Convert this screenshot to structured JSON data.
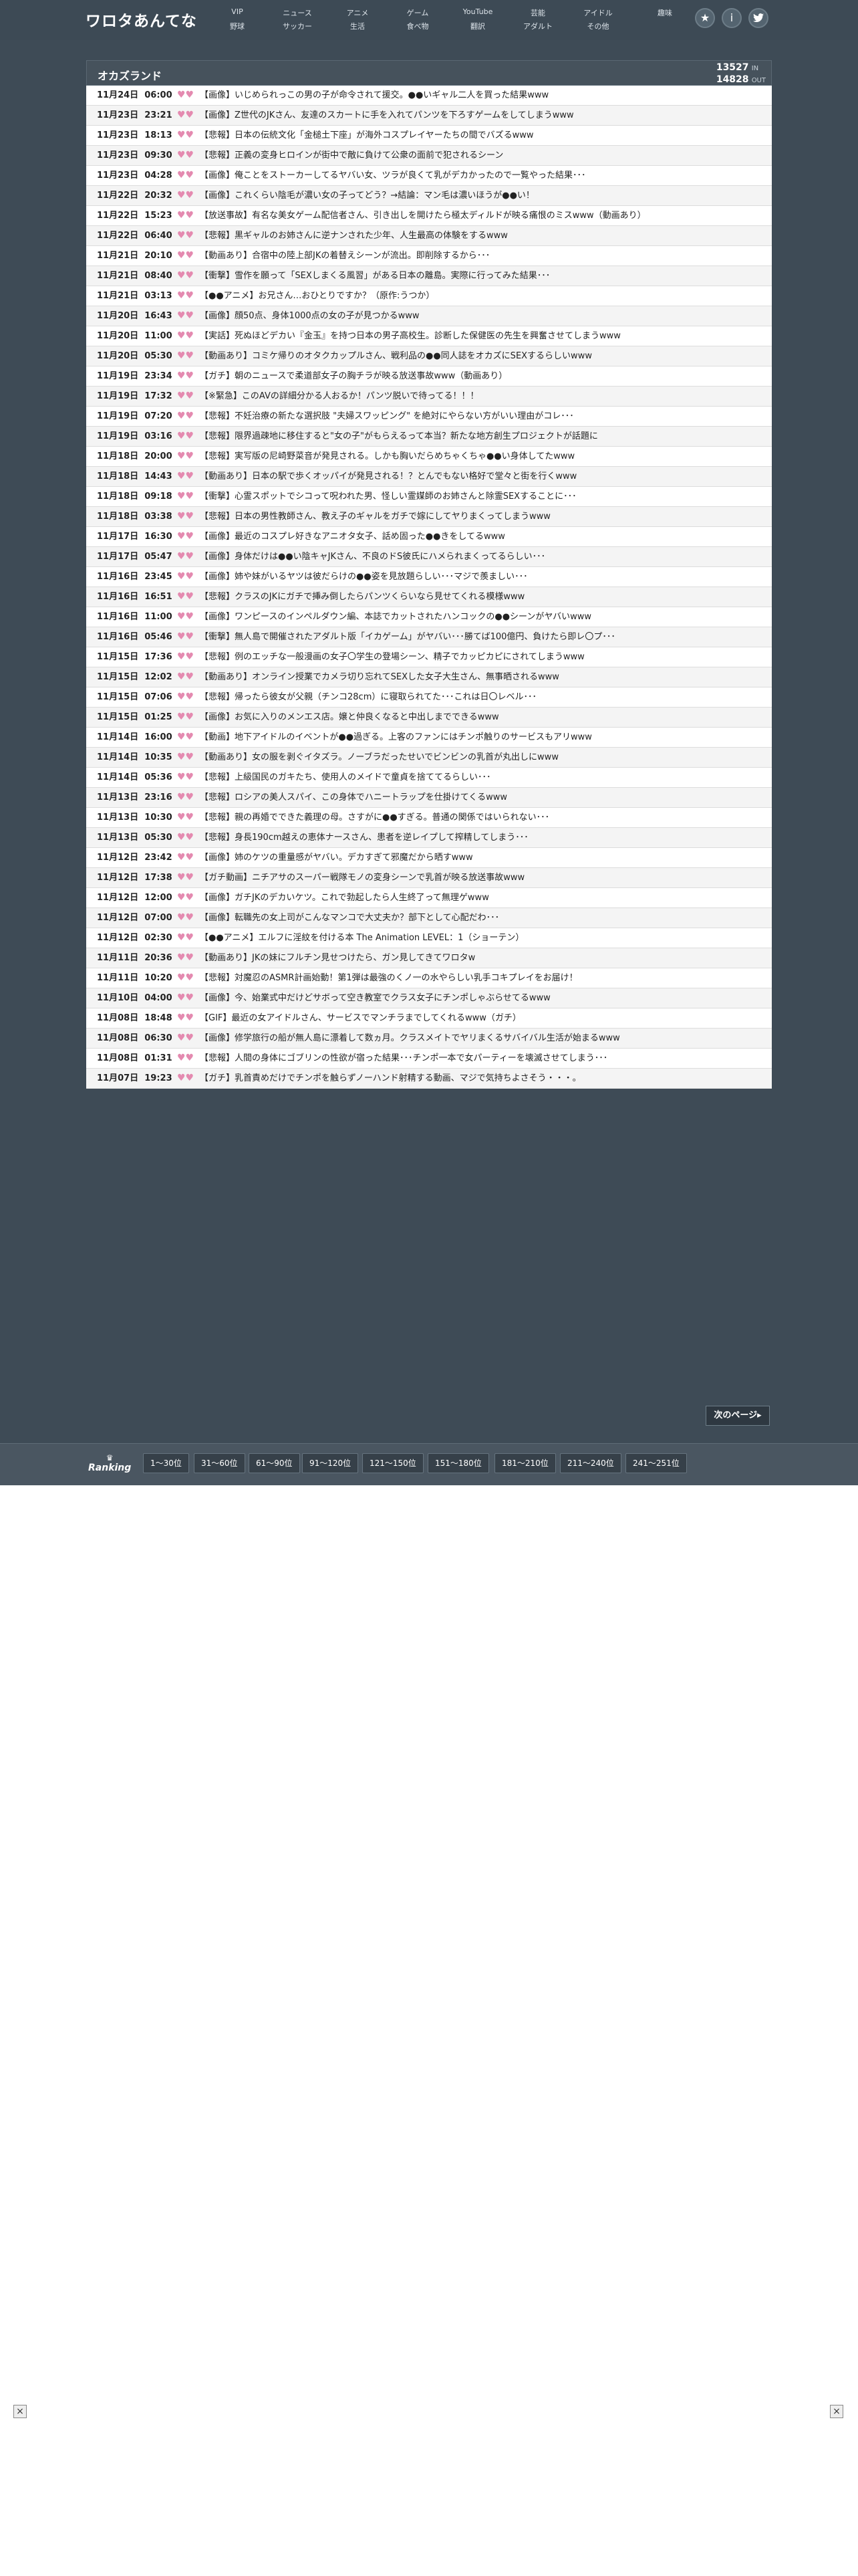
{
  "header": {
    "logo": "ワロタあんてな",
    "nav": [
      {
        "top": "VIP",
        "bottom": "野球"
      },
      {
        "top": "ニュース",
        "bottom": "サッカー"
      },
      {
        "top": "アニメ",
        "bottom": "生活"
      },
      {
        "top": "ゲーム",
        "bottom": "食べ物"
      },
      {
        "top": "YouTube",
        "bottom": "翻訳"
      },
      {
        "top": "芸能",
        "bottom": "アダルト"
      },
      {
        "top": "アイドル",
        "bottom": "その他"
      },
      {
        "top": "趣味",
        "bottom": ""
      }
    ],
    "icons": [
      "star-icon",
      "info-icon",
      "twitter-icon"
    ]
  },
  "panel": {
    "site_title": "オカズランド",
    "in_count": "13527",
    "in_label": "IN",
    "out_count": "14828",
    "out_label": "OUT"
  },
  "articles": [
    {
      "date": "11月24日",
      "time": "06:00",
      "title": "【画像】いじめられっこの男の子が命令されて援交。●●いギャル二人を買った結果www"
    },
    {
      "date": "11月23日",
      "time": "23:21",
      "title": "【画像】Z世代のJKさん、友達のスカートに手を入れてパンツを下ろすゲームをしてしまうwww"
    },
    {
      "date": "11月23日",
      "time": "18:13",
      "title": "【悲報】日本の伝統文化「金槌土下座」が海外コスプレイヤーたちの間でバズるwww"
    },
    {
      "date": "11月23日",
      "time": "09:30",
      "title": "【悲報】正義の変身ヒロインが街中で敵に負けて公衆の面前で犯されるシーン"
    },
    {
      "date": "11月23日",
      "time": "04:28",
      "title": "【画像】俺ことをストーカーしてるヤバい女、ツラが良くて乳がデカかったので一覧やった結果･･･"
    },
    {
      "date": "11月22日",
      "time": "20:32",
      "title": "【画像】これくらい陰毛が濃い女の子ってどう？→結論：マン毛は濃いほうが●●い！"
    },
    {
      "date": "11月22日",
      "time": "15:23",
      "title": "【放送事故】有名な美女ゲーム配信者さん、引き出しを開けたら極太ディルドが映る痛恨のミスwww（動画あり）"
    },
    {
      "date": "11月22日",
      "time": "06:40",
      "title": "【悲報】黒ギャルのお姉さんに逆ナンされた少年、人生最高の体験をするwww"
    },
    {
      "date": "11月21日",
      "time": "20:10",
      "title": "【動画あり】合宿中の陸上部JKの着替えシーンが流出。即削除するから･･･"
    },
    {
      "date": "11月21日",
      "time": "08:40",
      "title": "【衝撃】雪作を願って「SEXしまくる風習」がある日本の離島。実際に行ってみた結果･･･"
    },
    {
      "date": "11月21日",
      "time": "03:13",
      "title": "【●●アニメ】お兄さん…おひとりですか？（原作:うつか）"
    },
    {
      "date": "11月20日",
      "time": "16:43",
      "title": "【画像】顔50点、身体1000点の女の子が見つかるwww"
    },
    {
      "date": "11月20日",
      "time": "11:00",
      "title": "【実話】死ぬほどデカい『金玉』を持つ日本の男子高校生。診断した保健医の先生を興奮させてしまうwww"
    },
    {
      "date": "11月20日",
      "time": "05:30",
      "title": "【動画あり】コミケ帰りのオタクカップルさん、戦利品の●●同人誌をオカズにSEXするらしいwww"
    },
    {
      "date": "11月19日",
      "time": "23:34",
      "title": "【ガチ】朝のニュースで柔道部女子の胸チラが映る放送事故www（動画あり）"
    },
    {
      "date": "11月19日",
      "time": "17:32",
      "title": "【※緊急】このAVの詳細分かる人おるか！パンツ脱いで待ってる！！！"
    },
    {
      "date": "11月19日",
      "time": "07:20",
      "title": "【悲報】不妊治療の新たな選択肢 \"夫婦スワッピング\" を絶対にやらない方がいい理由がコレ･･･"
    },
    {
      "date": "11月19日",
      "time": "03:16",
      "title": "【悲報】限界過疎地に移住すると\"女の子\"がもらえるって本当？新たな地方創生プロジェクトが話題に"
    },
    {
      "date": "11月18日",
      "time": "20:00",
      "title": "【悲報】実写版の尼崎野菜音が発見される。しかも胸いだらめちゃくちゃ●●い身体してたwww"
    },
    {
      "date": "11月18日",
      "time": "14:43",
      "title": "【動画あり】日本の駅で歩くオッパイが発見される！？とんでもない格好で堂々と街を行くwww"
    },
    {
      "date": "11月18日",
      "time": "09:18",
      "title": "【衝撃】心霊スポットでシコって呪われた男、怪しい霊媒師のお姉さんと除霊SEXすることに･･･"
    },
    {
      "date": "11月18日",
      "time": "03:38",
      "title": "【悲報】日本の男性教師さん、教え子のギャルをガチで嫁にしてヤりまくってしまうwww"
    },
    {
      "date": "11月17日",
      "time": "16:30",
      "title": "【画像】最近のコスプレ好きなアニオタ女子、話め固った●●きをしてるwww"
    },
    {
      "date": "11月17日",
      "time": "05:47",
      "title": "【画像】身体だけは●●い陰キャJKさん、不良のドS彼氏にハメられまくってるらしい･･･"
    },
    {
      "date": "11月16日",
      "time": "23:45",
      "title": "【画像】姉や妹がいるヤツは彼だらけの●●姿を見放題らしい･･･マジで羨ましい･･･"
    },
    {
      "date": "11月16日",
      "time": "16:51",
      "title": "【悲報】クラスのJKにガチで挿み倒したらパンツくらいなら見せてくれる模様www"
    },
    {
      "date": "11月16日",
      "time": "11:00",
      "title": "【画像】ワンピースのインペルダウン編、本誌でカットされたハンコックの●●シーンがヤバいwww"
    },
    {
      "date": "11月16日",
      "time": "05:46",
      "title": "【衝撃】無人島で開催されたアダルト版「イカゲーム」がヤバい･･･勝てば100億円、負けたら即レ〇プ･･･"
    },
    {
      "date": "11月15日",
      "time": "17:36",
      "title": "【悲報】例のエッチな一般漫画の女子〇学生の登場シーン、精子でカッピカピにされてしまうwww"
    },
    {
      "date": "11月15日",
      "time": "12:02",
      "title": "【動画あり】オンライン授業でカメラ切り忘れてSEXした女子大生さん、無事晒されるwww"
    },
    {
      "date": "11月15日",
      "time": "07:06",
      "title": "【悲報】帰ったら彼女が父親（チンコ28cm）に寝取られてた･･･これは日〇レベル･･･"
    },
    {
      "date": "11月15日",
      "time": "01:25",
      "title": "【画像】お気に入りのメンエス店。嬢と仲良くなると中出しまでできるwww"
    },
    {
      "date": "11月14日",
      "time": "16:00",
      "title": "【動画】地下アイドルのイベントが●●過ぎる。上客のファンにはチンポ触りのサービスもアリwww"
    },
    {
      "date": "11月14日",
      "time": "10:35",
      "title": "【動画あり】女の服を剥ぐイタズラ。ノーブラだったせいでビンビンの乳首が丸出しにwww"
    },
    {
      "date": "11月14日",
      "time": "05:36",
      "title": "【悲報】上級国民のガキたち、使用人のメイドで童貞を捨ててるらしい･･･"
    },
    {
      "date": "11月13日",
      "time": "23:16",
      "title": "【悲報】ロシアの美人スパイ、この身体でハニートラップを仕掛けてくるwww"
    },
    {
      "date": "11月13日",
      "time": "10:30",
      "title": "【悲報】親の再婚でできた義理の母。さすがに●●すぎる。普通の関係ではいられない･･･"
    },
    {
      "date": "11月13日",
      "time": "05:30",
      "title": "【悲報】身長190cm越えの恵体ナースさん、患者を逆レイプして搾精してしまう･･･"
    },
    {
      "date": "11月12日",
      "time": "23:42",
      "title": "【画像】姉のケツの重量感がヤバい。デカすぎて邪魔だから晒すwww"
    },
    {
      "date": "11月12日",
      "time": "17:38",
      "title": "【ガチ動画】ニチアサのスーパー戦隊モノの変身シーンで乳首が映る放送事故www"
    },
    {
      "date": "11月12日",
      "time": "12:00",
      "title": "【画像】ガチJKのデカいケツ。これで勃起したら人生終了って無理ゲwww"
    },
    {
      "date": "11月12日",
      "time": "07:00",
      "title": "【画像】転職先の女上司がこんなマンコで大丈夫か？部下として心配だわ･･･"
    },
    {
      "date": "11月12日",
      "time": "02:30",
      "title": "【●●アニメ】エルフに淫紋を付ける本 The Animation LEVEL：1（ショーテン）"
    },
    {
      "date": "11月11日",
      "time": "20:36",
      "title": "【動画あり】JKの妹にフルチン見せつけたら、ガン見してきてワロタw"
    },
    {
      "date": "11月11日",
      "time": "10:20",
      "title": "【悲報】対魔忍のASMR計画始動！第1弾は最強のくノ一の水やらしい乳手コキプレイをお届け！"
    },
    {
      "date": "11月10日",
      "time": "04:00",
      "title": "【画像】今、始業式中だけどサボって空き教室でクラス女子にチンポしゃぶらせてるwww"
    },
    {
      "date": "11月08日",
      "time": "18:48",
      "title": "【GIF】最近の女アイドルさん、サービスでマンチラまでしてくれるwww（ガチ）"
    },
    {
      "date": "11月08日",
      "time": "06:30",
      "title": "【画像】修学旅行の船が無人島に漂着して数ヵ月。クラスメイトでヤリまくるサバイバル生活が始まるwww"
    },
    {
      "date": "11月08日",
      "time": "01:31",
      "title": "【悲報】人間の身体にゴブリンの性欲が宿った結果･･･チンポ一本で女パーティーを壊滅させてしまう･･･"
    },
    {
      "date": "11月07日",
      "time": "19:23",
      "title": "【ガチ】乳首責めだけでチンポを触らずノーハンド射精する動画、マジで気持ちよさそう・・・。"
    }
  ],
  "next_page_label": "次のページ▸",
  "ranking": {
    "label": "Ranking",
    "tabs": [
      "1〜30位",
      "31〜60位",
      "61〜90位",
      "91〜120位",
      "121〜150位",
      "151〜180位",
      "181〜210位",
      "211〜240位",
      "241〜251位"
    ]
  },
  "close_label": "×"
}
